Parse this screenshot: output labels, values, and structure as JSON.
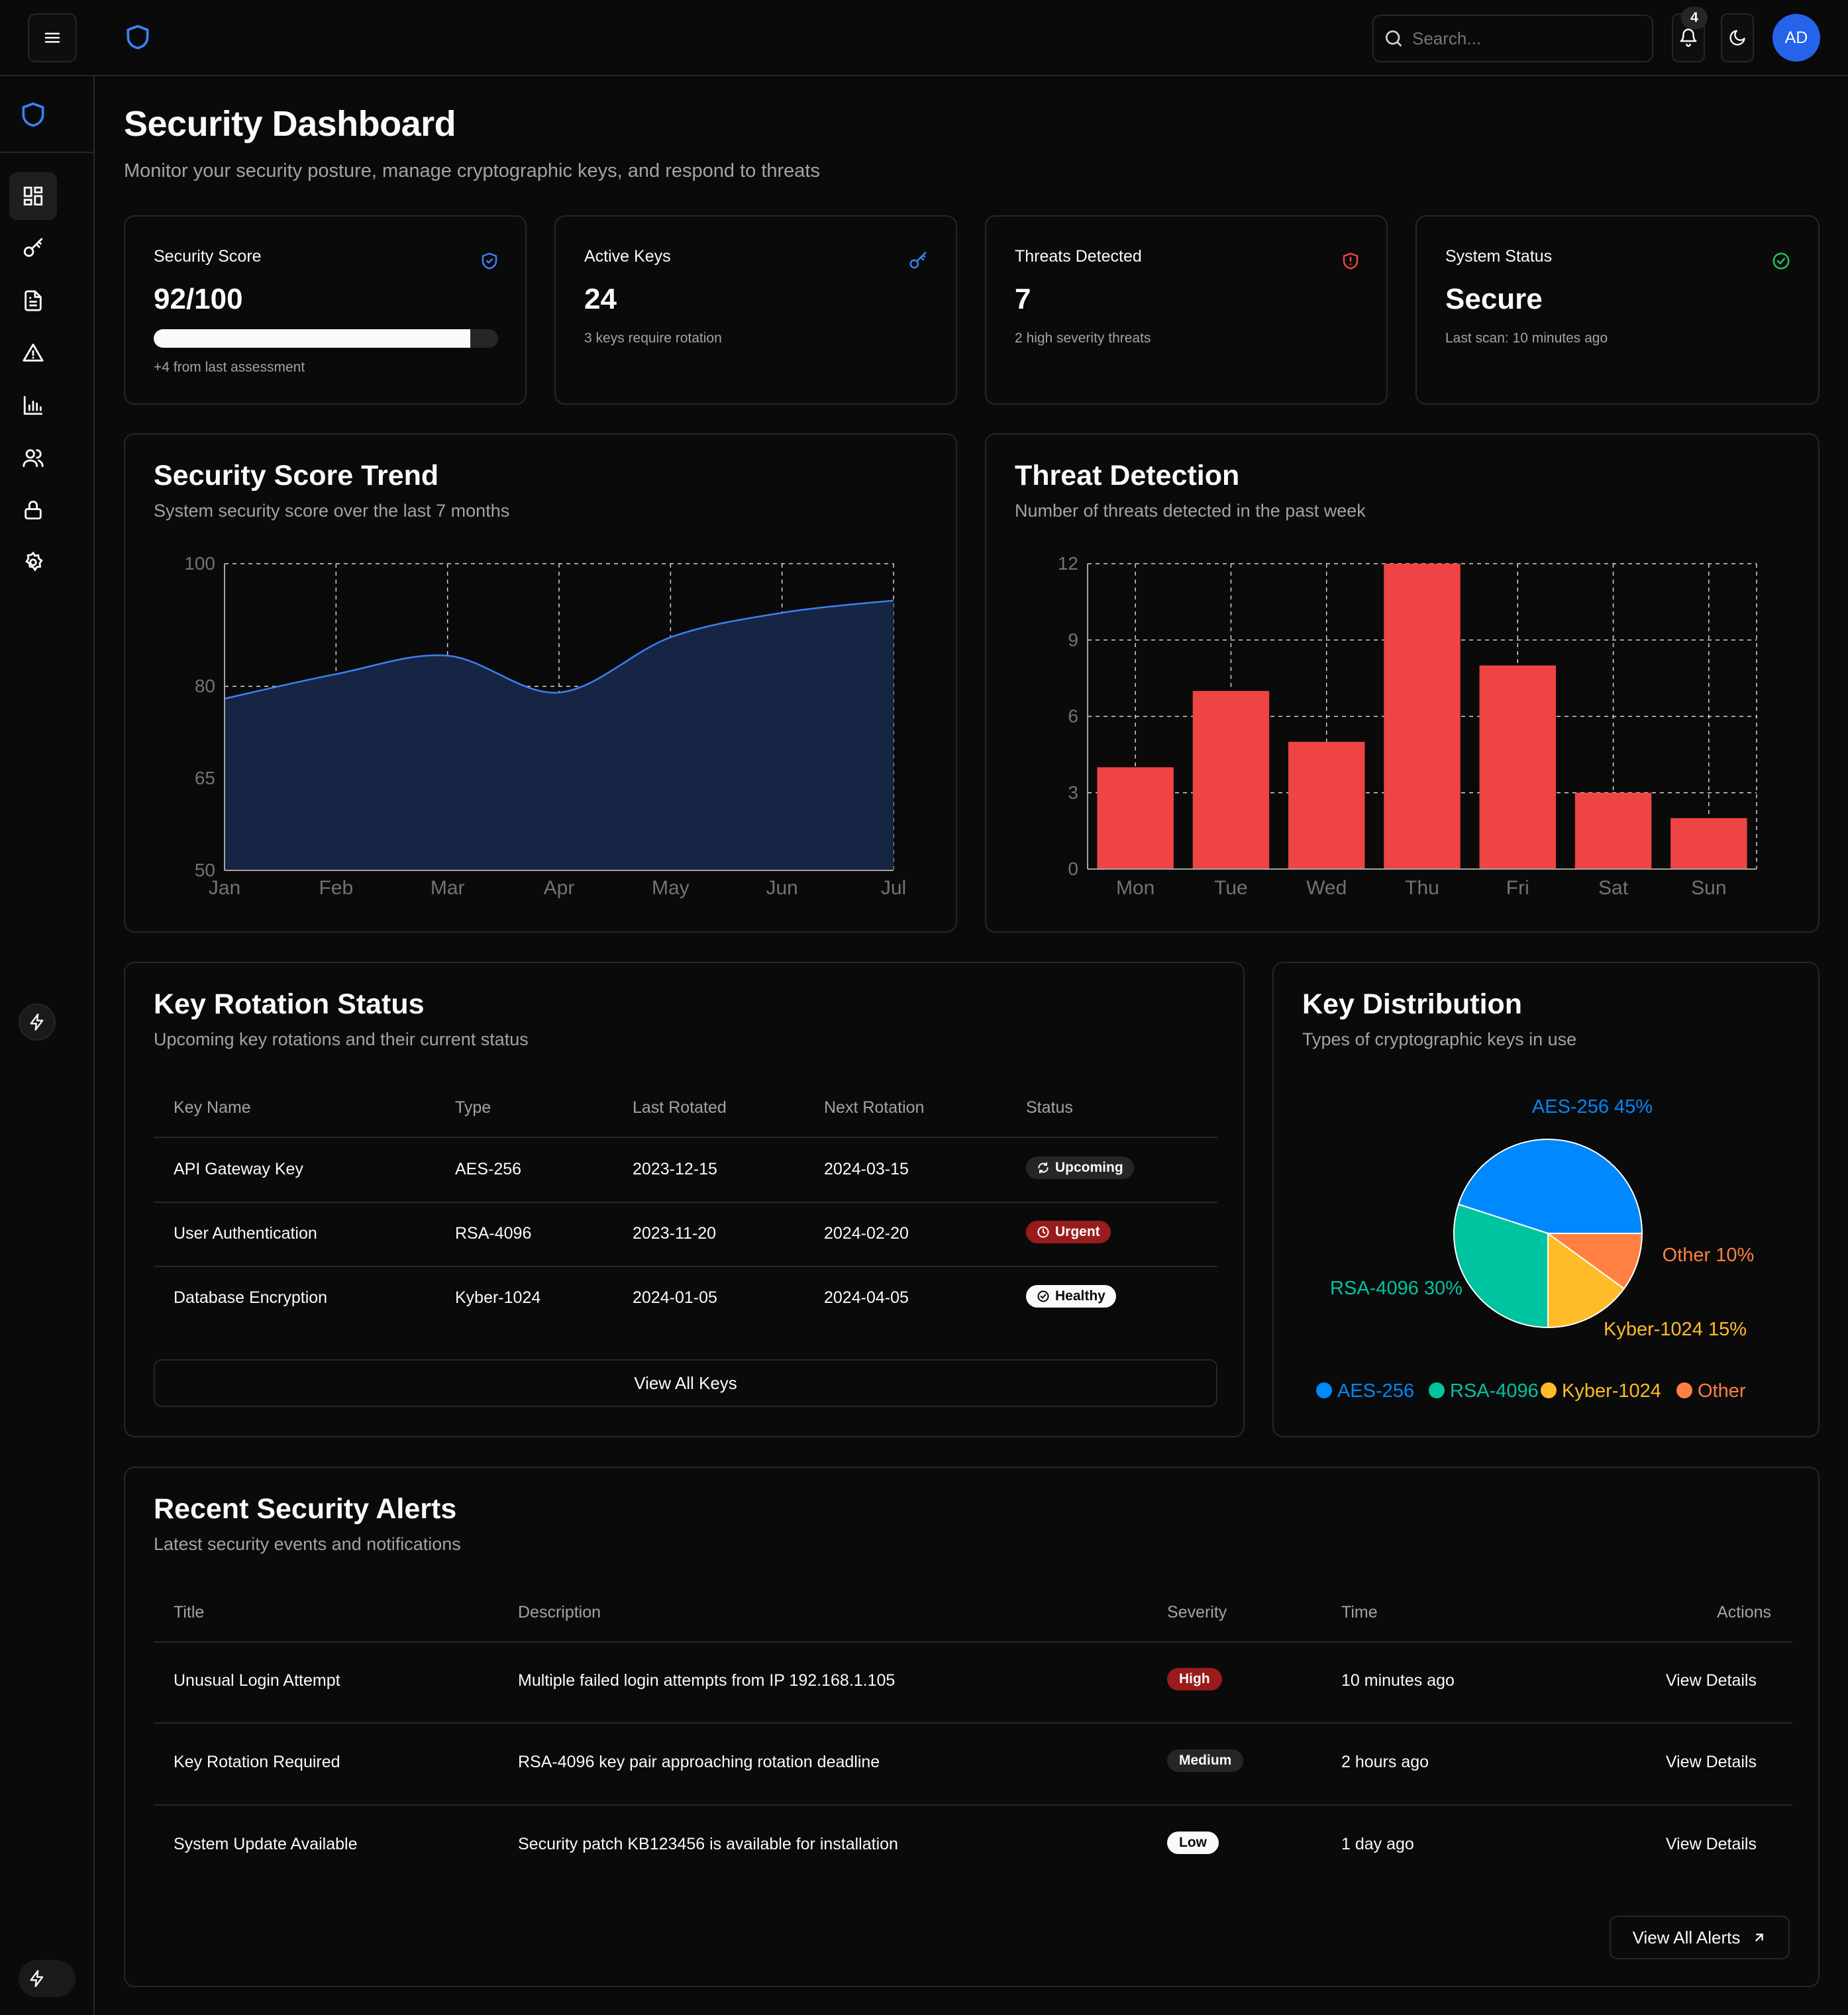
{
  "topbar": {
    "search_placeholder": "Search...",
    "notification_count": "4",
    "avatar_initials": "AD"
  },
  "page": {
    "title": "Security Dashboard",
    "subtitle": "Monitor your security posture, manage cryptographic keys, and respond to threats"
  },
  "stats": [
    {
      "label": "Security Score",
      "value": "92/100",
      "note": "+4 from last assessment",
      "progress": 0.92,
      "icon": "shield-icon",
      "color": "#3b82f6"
    },
    {
      "label": "Active Keys",
      "value": "24",
      "note": "3 keys require rotation",
      "icon": "key-icon",
      "color": "#3b82f6"
    },
    {
      "label": "Threats Detected",
      "value": "7",
      "note": "2 high severity threats",
      "icon": "shield-alert-icon",
      "color": "#ef4444"
    },
    {
      "label": "System Status",
      "value": "Secure",
      "note": "Last scan: 10 minutes ago",
      "icon": "check-circle-icon",
      "color": "#22c55e"
    }
  ],
  "trend": {
    "title": "Security Score Trend",
    "subtitle": "System security score over the last 7 months"
  },
  "threats": {
    "title": "Threat Detection",
    "subtitle": "Number of threats detected in the past week"
  },
  "chart_data": [
    {
      "type": "area",
      "categories": [
        "Jan",
        "Feb",
        "Mar",
        "Apr",
        "May",
        "Jun",
        "Jul"
      ],
      "values": [
        78,
        82,
        85,
        79,
        88,
        92,
        94
      ],
      "yticks": [
        50,
        65,
        80,
        100
      ],
      "ylim": [
        50,
        100
      ],
      "grid": true,
      "color": "#3b82f6",
      "fill": "#172544"
    },
    {
      "type": "bar",
      "categories": [
        "Mon",
        "Tue",
        "Wed",
        "Thu",
        "Fri",
        "Sat",
        "Sun"
      ],
      "values": [
        4,
        7,
        5,
        12,
        8,
        3,
        2
      ],
      "yticks": [
        0,
        3,
        6,
        9,
        12
      ],
      "ylim": [
        0,
        12
      ],
      "grid": true,
      "color": "#ef4444"
    },
    {
      "type": "pie",
      "slices": [
        {
          "name": "AES-256",
          "value": 45,
          "label": "AES-256 45%",
          "color": "#0088fe"
        },
        {
          "name": "RSA-4096",
          "value": 30,
          "label": "RSA-4096 30%",
          "color": "#00c49f"
        },
        {
          "name": "Kyber-1024",
          "value": 15,
          "label": "Kyber-1024 15%",
          "color": "#ffbb28"
        },
        {
          "name": "Other",
          "value": 10,
          "label": "Other 10%",
          "color": "#ff8042"
        }
      ],
      "legend_position": "bottom"
    }
  ],
  "rotation": {
    "title": "Key Rotation Status",
    "subtitle": "Upcoming key rotations and their current status",
    "headers": [
      "Key Name",
      "Type",
      "Last Rotated",
      "Next Rotation",
      "Status"
    ],
    "rows": [
      {
        "name": "API Gateway Key",
        "type": "AES-256",
        "last": "2023-12-15",
        "next": "2024-03-15",
        "status": "Upcoming"
      },
      {
        "name": "User Authentication",
        "type": "RSA-4096",
        "last": "2023-11-20",
        "next": "2024-02-20",
        "status": "Urgent"
      },
      {
        "name": "Database Encryption",
        "type": "Kyber-1024",
        "last": "2024-01-05",
        "next": "2024-04-05",
        "status": "Healthy"
      }
    ],
    "view_all": "View All Keys"
  },
  "distribution": {
    "title": "Key Distribution",
    "subtitle": "Types of cryptographic keys in use"
  },
  "alerts": {
    "title": "Recent Security Alerts",
    "subtitle": "Latest security events and notifications",
    "headers": [
      "Title",
      "Description",
      "Severity",
      "Time",
      "Actions"
    ],
    "rows": [
      {
        "title": "Unusual Login Attempt",
        "desc": "Multiple failed login attempts from IP 192.168.1.105",
        "severity": "High",
        "time": "10 minutes ago",
        "action": "View Details"
      },
      {
        "title": "Key Rotation Required",
        "desc": "RSA-4096 key pair approaching rotation deadline",
        "severity": "Medium",
        "time": "2 hours ago",
        "action": "View Details"
      },
      {
        "title": "System Update Available",
        "desc": "Security patch KB123456 is available for installation",
        "severity": "Low",
        "time": "1 day ago",
        "action": "View Details"
      }
    ],
    "view_all": "View All Alerts"
  }
}
